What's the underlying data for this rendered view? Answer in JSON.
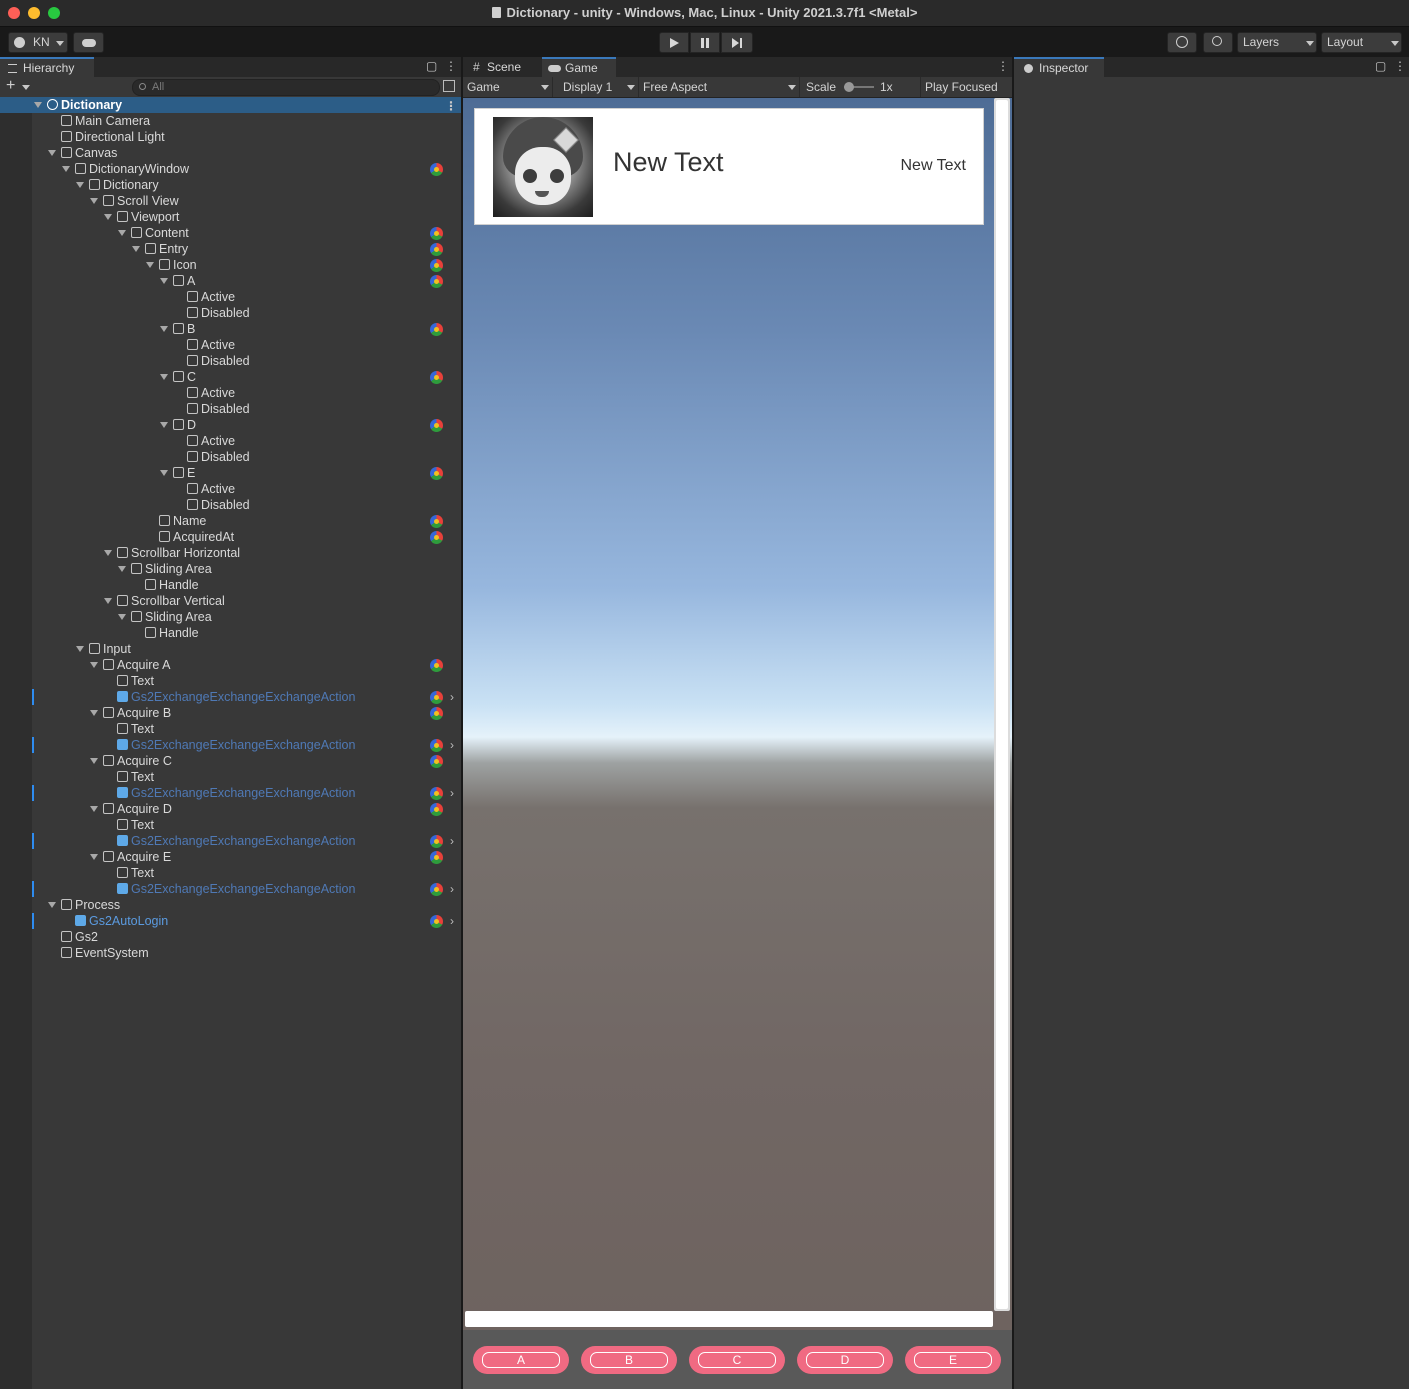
{
  "window": {
    "title": "Dictionary - unity - Windows, Mac, Linux - Unity 2021.3.7f1 <Metal>"
  },
  "toolbar": {
    "account": "KN",
    "layers": "Layers",
    "layout": "Layout"
  },
  "hierarchy": {
    "tab": "Hierarchy",
    "search_placeholder": "All",
    "rows": [
      {
        "label": "Dictionary",
        "depth": 0,
        "fold": true,
        "selected": true,
        "icon": "scene"
      },
      {
        "label": "Main Camera",
        "depth": 1
      },
      {
        "label": "Directional Light",
        "depth": 1
      },
      {
        "label": "Canvas",
        "depth": 1,
        "fold": true
      },
      {
        "label": "DictionaryWindow",
        "depth": 2,
        "fold": true,
        "cmp": true
      },
      {
        "label": "Dictionary",
        "depth": 3,
        "fold": true
      },
      {
        "label": "Scroll View",
        "depth": 4,
        "fold": true
      },
      {
        "label": "Viewport",
        "depth": 5,
        "fold": true
      },
      {
        "label": "Content",
        "depth": 6,
        "fold": true,
        "cmp": true
      },
      {
        "label": "Entry",
        "depth": 7,
        "fold": true,
        "cmp": true
      },
      {
        "label": "Icon",
        "depth": 8,
        "fold": true,
        "cmp": true
      },
      {
        "label": "A",
        "depth": 9,
        "fold": true,
        "cmp": true
      },
      {
        "label": "Active",
        "depth": 10
      },
      {
        "label": "Disabled",
        "depth": 10
      },
      {
        "label": "B",
        "depth": 9,
        "fold": true,
        "cmp": true
      },
      {
        "label": "Active",
        "depth": 10
      },
      {
        "label": "Disabled",
        "depth": 10
      },
      {
        "label": "C",
        "depth": 9,
        "fold": true,
        "cmp": true
      },
      {
        "label": "Active",
        "depth": 10
      },
      {
        "label": "Disabled",
        "depth": 10
      },
      {
        "label": "D",
        "depth": 9,
        "fold": true,
        "cmp": true
      },
      {
        "label": "Active",
        "depth": 10
      },
      {
        "label": "Disabled",
        "depth": 10
      },
      {
        "label": "E",
        "depth": 9,
        "fold": true,
        "cmp": true
      },
      {
        "label": "Active",
        "depth": 10
      },
      {
        "label": "Disabled",
        "depth": 10
      },
      {
        "label": "Name",
        "depth": 8,
        "cmp": true
      },
      {
        "label": "AcquiredAt",
        "depth": 8,
        "cmp": true
      },
      {
        "label": "Scrollbar Horizontal",
        "depth": 5,
        "fold": true
      },
      {
        "label": "Sliding Area",
        "depth": 6,
        "fold": true
      },
      {
        "label": "Handle",
        "depth": 7
      },
      {
        "label": "Scrollbar Vertical",
        "depth": 5,
        "fold": true
      },
      {
        "label": "Sliding Area",
        "depth": 6,
        "fold": true
      },
      {
        "label": "Handle",
        "depth": 7
      },
      {
        "label": "Input",
        "depth": 3,
        "fold": true
      },
      {
        "label": "Acquire A",
        "depth": 4,
        "fold": true,
        "cmp": true
      },
      {
        "label": "Text",
        "depth": 5
      },
      {
        "label": "Gs2ExchangeExchangeExchangeAction",
        "depth": 5,
        "prefab": "faded",
        "cmp": true,
        "arrow": true,
        "override": true
      },
      {
        "label": "Acquire B",
        "depth": 4,
        "fold": true,
        "cmp": true
      },
      {
        "label": "Text",
        "depth": 5
      },
      {
        "label": "Gs2ExchangeExchangeExchangeAction",
        "depth": 5,
        "prefab": "faded",
        "cmp": true,
        "arrow": true,
        "override": true
      },
      {
        "label": "Acquire C",
        "depth": 4,
        "fold": true,
        "cmp": true
      },
      {
        "label": "Text",
        "depth": 5
      },
      {
        "label": "Gs2ExchangeExchangeExchangeAction",
        "depth": 5,
        "prefab": "faded",
        "cmp": true,
        "arrow": true,
        "override": true
      },
      {
        "label": "Acquire D",
        "depth": 4,
        "fold": true,
        "cmp": true
      },
      {
        "label": "Text",
        "depth": 5
      },
      {
        "label": "Gs2ExchangeExchangeExchangeAction",
        "depth": 5,
        "prefab": "faded",
        "cmp": true,
        "arrow": true,
        "override": true
      },
      {
        "label": "Acquire E",
        "depth": 4,
        "fold": true,
        "cmp": true
      },
      {
        "label": "Text",
        "depth": 5
      },
      {
        "label": "Gs2ExchangeExchangeExchangeAction",
        "depth": 5,
        "prefab": "faded",
        "cmp": true,
        "arrow": true,
        "override": true
      },
      {
        "label": "Process",
        "depth": 1,
        "fold": true
      },
      {
        "label": "Gs2AutoLogin",
        "depth": 2,
        "prefab": "bright",
        "cmp": true,
        "arrow": true,
        "override": true
      },
      {
        "label": "Gs2",
        "depth": 1
      },
      {
        "label": "EventSystem",
        "depth": 1
      }
    ]
  },
  "game": {
    "tab_scene": "Scene",
    "tab_game": "Game",
    "mode": "Game",
    "display": "Display 1",
    "aspect": "Free Aspect",
    "scale_label": "Scale",
    "scale_value": "1x",
    "play_focused": "Play Focused",
    "entry": {
      "name": "New Text",
      "acquired_at": "New Text"
    },
    "buttons": [
      "A",
      "B",
      "C",
      "D",
      "E"
    ],
    "accent": "#f06a82"
  },
  "inspector": {
    "tab": "Inspector"
  }
}
